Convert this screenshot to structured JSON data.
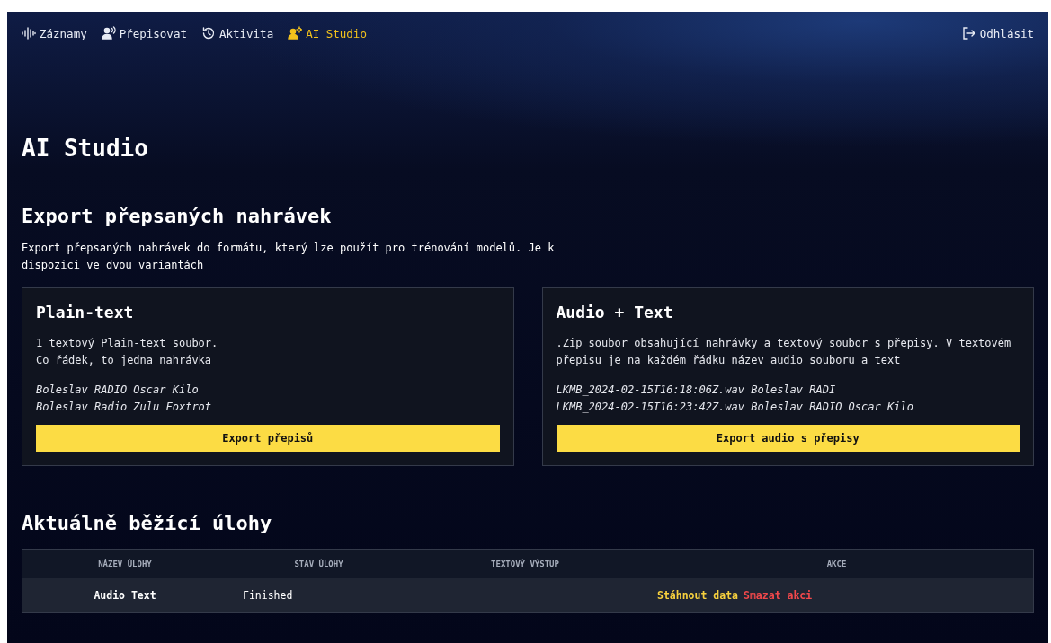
{
  "nav": {
    "items": [
      {
        "kind": "waveform",
        "label": "Záznamy",
        "selected": false
      },
      {
        "kind": "speaker",
        "label": "Přepisovat",
        "selected": false
      },
      {
        "kind": "history",
        "label": "Aktivita",
        "selected": false
      },
      {
        "kind": "team",
        "label": "AI Studio",
        "selected": true
      }
    ],
    "logout": "Odhlásit"
  },
  "page_title": "AI Studio",
  "export": {
    "title": "Export přepsaných nahrávek",
    "description": "Export přepsaných nahrávek do formátu, který lze použít pro trénování modelů. Je k dispozici ve dvou variantách",
    "cards": [
      {
        "title": "Plain-text",
        "description": [
          "1 textový Plain-text soubor.",
          "Co řádek, to jedna nahrávka"
        ],
        "examples": [
          "Boleslav RADIO Oscar Kilo",
          "Boleslav Radio Zulu Foxtrot"
        ],
        "button": "Export přepisů"
      },
      {
        "title": "Audio + Text",
        "description": [
          ".Zip soubor obsahující nahrávky a textový soubor s přepisy. V textovém přepisu je na každém řádku název audio souboru a text"
        ],
        "examples": [
          "LKMB_2024-02-15T16:18:06Z.wav Boleslav RADI",
          "LKMB_2024-02-15T16:23:42Z.wav Boleslav RADIO Oscar Kilo"
        ],
        "button": "Export audio s přepisy"
      }
    ]
  },
  "tasks": {
    "title": "Aktuálně běžící úlohy",
    "columns": [
      "NÁZEV ÚLOHY",
      "STAV ÚLOHY",
      "TEXTOVÝ VÝSTUP",
      "AKCE"
    ],
    "rows": [
      {
        "name": "Audio Text",
        "status": "Finished",
        "actions": [
          {
            "kind": "download",
            "label": "Stáhnout data"
          },
          {
            "kind": "delete",
            "label": "Smazat akci"
          }
        ]
      }
    ]
  }
}
